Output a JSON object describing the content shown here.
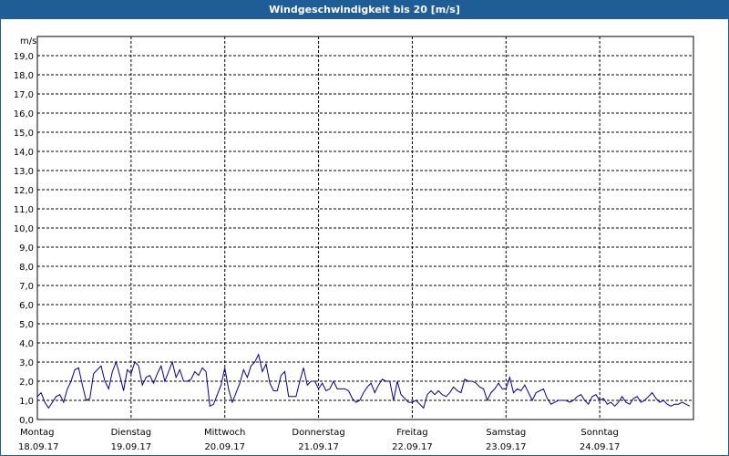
{
  "window": {
    "title": "Windgeschwindigkeit bis 20 [m/s]"
  },
  "colors": {
    "titlebar": "#1f5d96",
    "series": "#00008b",
    "grid": "#000000"
  },
  "chart_data": {
    "type": "line",
    "title": "Windgeschwindigkeit bis 20 [m/s]",
    "ylabel": "m/s",
    "ylim": [
      0,
      20
    ],
    "xlim": [
      0,
      7
    ],
    "y_ticks": [
      "0,0",
      "1,0",
      "2,0",
      "3,0",
      "4,0",
      "5,0",
      "6,0",
      "7,0",
      "8,0",
      "9,0",
      "10,0",
      "11,0",
      "12,0",
      "13,0",
      "14,0",
      "15,0",
      "16,0",
      "17,0",
      "18,0",
      "19,0"
    ],
    "x_ticks": [
      {
        "day": "Montag",
        "date": "18.09.17"
      },
      {
        "day": "Dienstag",
        "date": "19.09.17"
      },
      {
        "day": "Mittwoch",
        "date": "20.09.17"
      },
      {
        "day": "Donnerstag",
        "date": "21.09.17"
      },
      {
        "day": "Freitag",
        "date": "22.09.17"
      },
      {
        "day": "Samstag",
        "date": "23.09.17"
      },
      {
        "day": "Sonntag",
        "date": "24.09.17"
      }
    ],
    "grid": true,
    "series": [
      {
        "x": [
          0,
          0.04,
          0.08,
          0.12,
          0.16,
          0.2,
          0.24,
          0.28,
          0.32,
          0.36,
          0.4,
          0.44,
          0.48,
          0.52,
          0.56,
          0.6,
          0.64,
          0.68,
          0.72,
          0.76,
          0.8,
          0.84,
          0.88,
          0.92,
          0.96,
          1.0,
          1.04,
          1.08,
          1.12,
          1.16,
          1.2,
          1.24,
          1.28,
          1.32,
          1.36,
          1.4,
          1.44,
          1.48,
          1.52,
          1.56,
          1.6,
          1.64,
          1.68,
          1.72,
          1.76,
          1.8,
          1.84,
          1.88,
          1.92,
          1.96,
          2.0,
          2.04,
          2.08,
          2.12,
          2.16,
          2.2,
          2.24,
          2.28,
          2.32,
          2.36,
          2.4,
          2.44,
          2.48,
          2.52,
          2.56,
          2.6,
          2.64,
          2.68,
          2.72,
          2.76,
          2.8,
          2.84,
          2.88,
          2.92,
          2.96,
          3.0,
          3.04,
          3.08,
          3.12,
          3.16,
          3.2,
          3.24,
          3.28,
          3.32,
          3.36,
          3.4,
          3.44,
          3.48,
          3.52,
          3.56,
          3.6,
          3.64,
          3.68,
          3.72,
          3.76,
          3.8,
          3.84,
          3.88,
          3.92,
          3.96,
          4.0,
          4.04,
          4.08,
          4.12,
          4.16,
          4.2,
          4.24,
          4.28,
          4.32,
          4.36,
          4.4,
          4.44,
          4.48,
          4.52,
          4.56,
          4.6,
          4.64,
          4.68,
          4.72,
          4.76,
          4.8,
          4.84,
          4.88,
          4.92,
          4.96,
          5.0,
          5.04,
          5.08,
          5.12,
          5.16,
          5.2,
          5.24,
          5.28,
          5.32,
          5.36,
          5.4,
          5.44,
          5.48,
          5.52,
          5.56,
          5.6,
          5.64,
          5.68,
          5.72,
          5.76,
          5.8,
          5.84,
          5.88,
          5.92,
          5.96,
          6.0,
          6.04,
          6.08,
          6.12,
          6.16,
          6.2,
          6.24,
          6.28,
          6.32,
          6.36,
          6.4,
          6.44,
          6.48,
          6.52,
          6.56,
          6.6,
          6.64,
          6.68,
          6.72,
          6.76,
          6.8,
          6.84,
          6.88,
          6.92,
          6.96
        ],
        "y": [
          1.2,
          1.4,
          0.9,
          0.6,
          0.9,
          1.2,
          1.3,
          0.9,
          1.6,
          2.0,
          2.6,
          2.7,
          1.8,
          1.0,
          1.1,
          2.4,
          2.6,
          2.8,
          2.0,
          1.6,
          2.5,
          3.0,
          2.3,
          1.5,
          2.6,
          2.4,
          3.0,
          2.8,
          1.8,
          2.2,
          2.3,
          1.9,
          2.4,
          2.8,
          2.0,
          2.5,
          3.0,
          2.2,
          2.6,
          2.0,
          2.0,
          2.1,
          2.5,
          2.3,
          2.7,
          2.5,
          0.7,
          0.8,
          1.3,
          1.8,
          2.7,
          1.6,
          0.9,
          1.4,
          1.9,
          2.6,
          2.2,
          2.8,
          3.0,
          3.4,
          2.5,
          2.9,
          1.9,
          1.5,
          1.5,
          2.3,
          2.5,
          1.2,
          1.2,
          1.2,
          2.0,
          2.7,
          1.8,
          2.0,
          2.0,
          1.6,
          1.9,
          1.5,
          1.6,
          2.0,
          1.6,
          1.6,
          1.6,
          1.5,
          1.1,
          0.9,
          1.0,
          1.4,
          1.7,
          1.9,
          1.4,
          1.8,
          2.1,
          2.0,
          2.0,
          1.0,
          2.0,
          1.3,
          1.1,
          0.9,
          0.9,
          1.0,
          0.8,
          0.6,
          1.3,
          1.5,
          1.3,
          1.5,
          1.3,
          1.2,
          1.4,
          1.7,
          1.5,
          1.4,
          2.1,
          2.0,
          2.0,
          1.9,
          1.7,
          1.6,
          1.0,
          1.4,
          1.6,
          1.9,
          1.6,
          1.6,
          2.2,
          1.4,
          1.6,
          1.5,
          1.8,
          1.4,
          1.0,
          1.4,
          1.5,
          1.6,
          1.1,
          0.8,
          0.9,
          1.0,
          1.0,
          1.0,
          0.9,
          1.0,
          1.2,
          1.3,
          1.0,
          0.8,
          1.2,
          1.3,
          1.0,
          1.1,
          0.8,
          0.9,
          0.7,
          0.9,
          1.2,
          0.9,
          0.8,
          1.1,
          1.2,
          0.9,
          1.0,
          1.2,
          1.4,
          1.1,
          0.9,
          1.0,
          0.8,
          0.7,
          0.8,
          0.8,
          0.9,
          0.8,
          0.7
        ]
      }
    ]
  }
}
